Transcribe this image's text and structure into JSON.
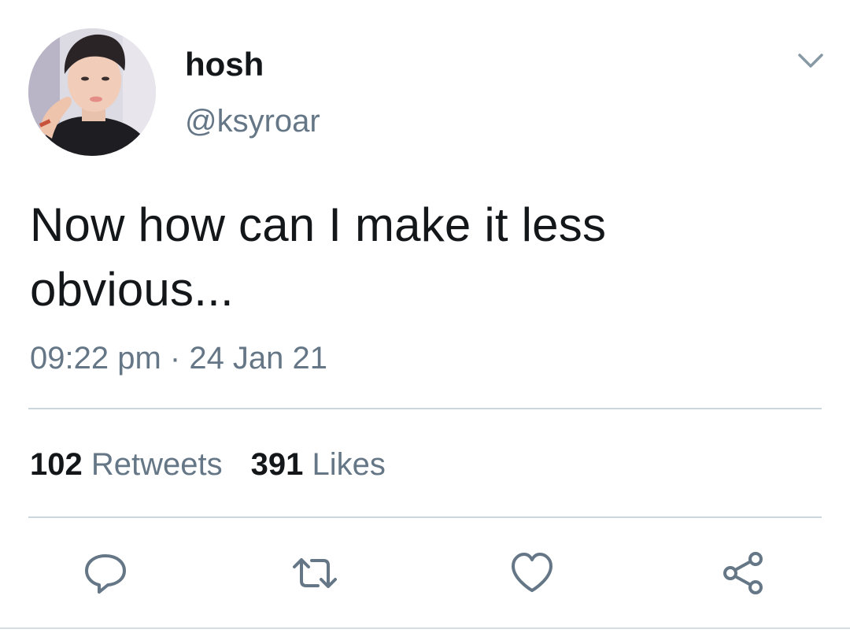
{
  "tweet": {
    "author": {
      "display_name": "hosh",
      "handle": "@ksyroar",
      "avatar_icon": "profile-photo"
    },
    "text_line1": "Now how can I make it less",
    "text_line2": "obvious...",
    "timestamp": "09:22 pm · 24 Jan 21",
    "stats": {
      "retweets_count": "102",
      "retweets_label": "Retweets",
      "likes_count": "391",
      "likes_label": "Likes"
    },
    "actions": [
      {
        "name": "reply",
        "icon": "reply-icon"
      },
      {
        "name": "retweet",
        "icon": "retweet-icon"
      },
      {
        "name": "like",
        "icon": "heart-icon"
      },
      {
        "name": "share",
        "icon": "share-icon"
      }
    ]
  },
  "colors": {
    "primary_text": "#14171a",
    "secondary_text": "#657786",
    "divider": "#ccd6dd",
    "icon": "#657786"
  }
}
